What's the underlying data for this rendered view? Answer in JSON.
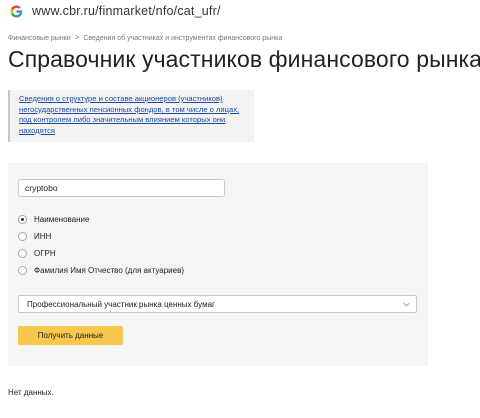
{
  "browser": {
    "url": "www.cbr.ru/finmarket/nfo/cat_ufr/",
    "icon": "google-g-icon"
  },
  "breadcrumb": {
    "items": [
      "Финансовые рынки",
      "Сведения об участниках и инструментах финансового рынка"
    ],
    "separator": ">"
  },
  "page": {
    "title": "Справочник участников финансового рынка",
    "info_link": "Сведения о структуре и составе акционеров (участников) негосударственных пенсионных фондов, в том числе о лицах, под контролем либо значительным влиянием которых они находятся"
  },
  "form": {
    "search_value": "cryptobo",
    "search_type_options": [
      {
        "label": "Наименование",
        "checked": true
      },
      {
        "label": "ИНН",
        "checked": false
      },
      {
        "label": "ОГРН",
        "checked": false
      },
      {
        "label": "Фамилия Имя Отчество (для актуариев)",
        "checked": false
      }
    ],
    "category_selected": "Профессиональный участник рынка ценных бумаг",
    "submit_label": "Получить данные"
  },
  "result": {
    "message": "Нет данных."
  },
  "colors": {
    "link": "#1a4da0",
    "button": "#f6c94e",
    "panel": "#f5f5f5",
    "info_box": "#f3f3f3"
  }
}
